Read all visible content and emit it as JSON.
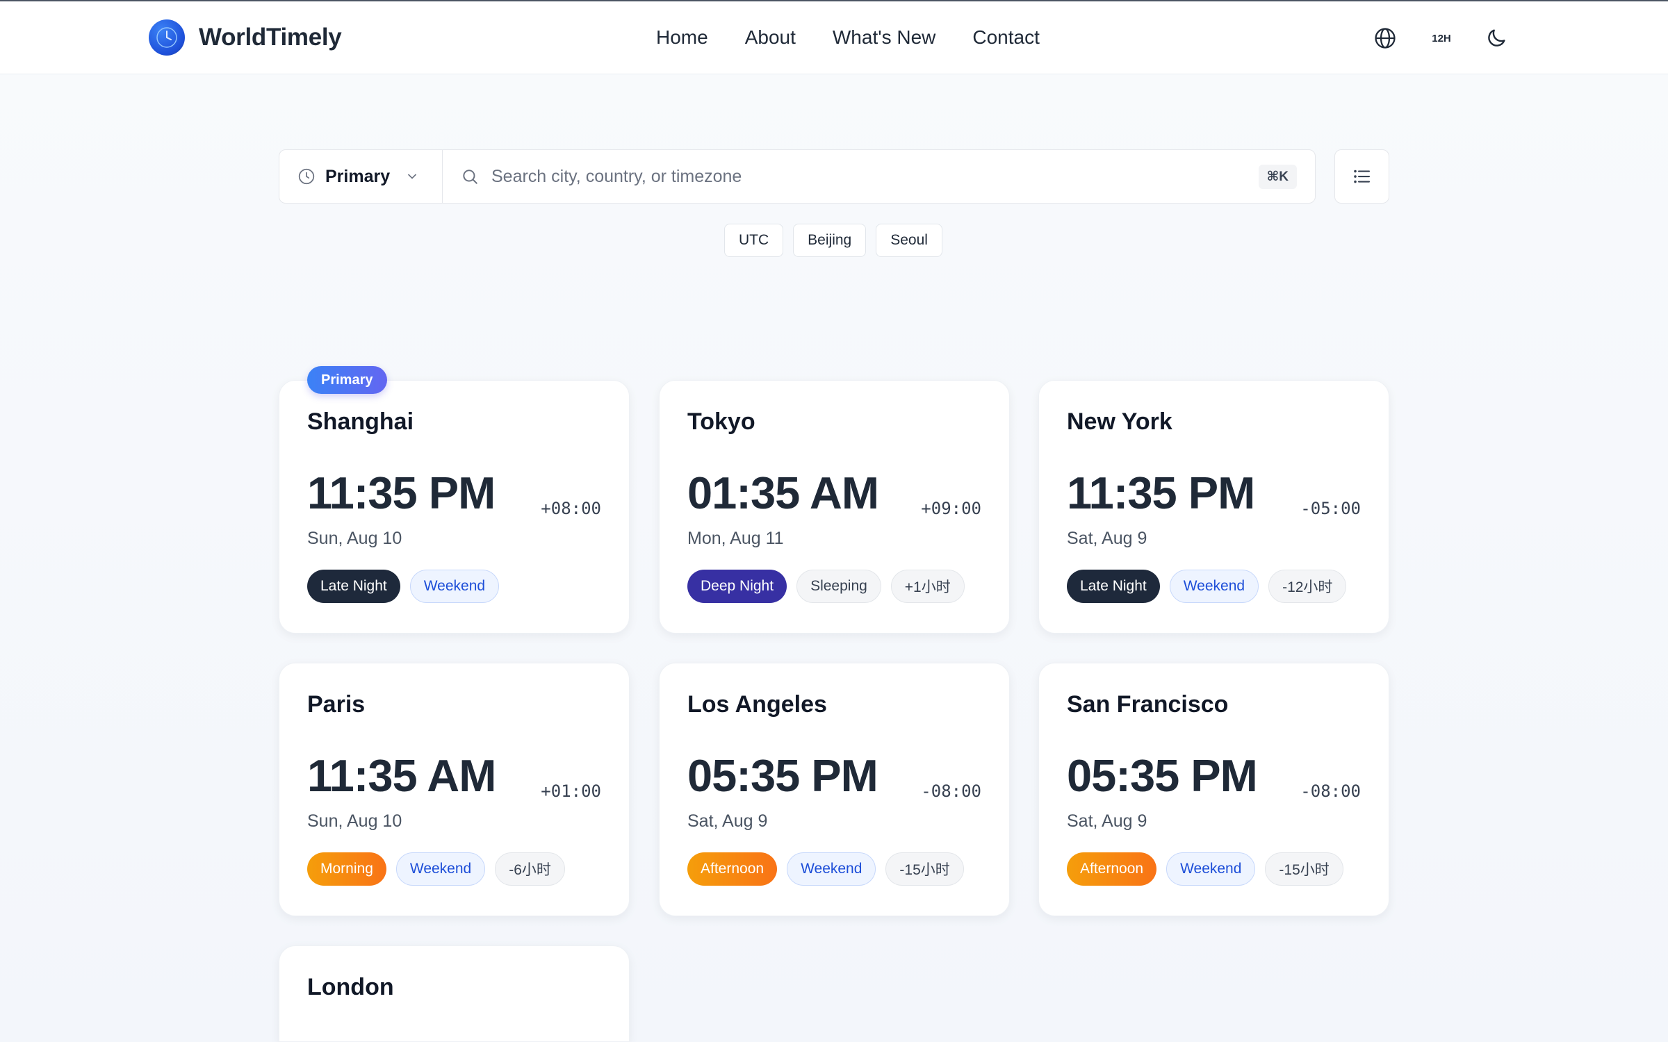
{
  "app": {
    "name": "WorldTimely"
  },
  "nav": {
    "items": [
      "Home",
      "About",
      "What's New",
      "Contact"
    ]
  },
  "header": {
    "time_format": "12H"
  },
  "search": {
    "mode": "Primary",
    "placeholder": "Search city, country, or timezone",
    "shortcut": "⌘K"
  },
  "quick_chips": [
    "UTC",
    "Beijing",
    "Seoul"
  ],
  "primary_badge": "Primary",
  "cards": [
    {
      "city": "Shanghai",
      "time": "11:35 PM",
      "offset": "+08:00",
      "date": "Sun, Aug 10",
      "tags": [
        {
          "label": "Late Night",
          "style": "dark"
        },
        {
          "label": "Weekend",
          "style": "blue"
        }
      ]
    },
    {
      "city": "Tokyo",
      "time": "01:35 AM",
      "offset": "+09:00",
      "date": "Mon, Aug 11",
      "tags": [
        {
          "label": "Deep Night",
          "style": "indigo"
        },
        {
          "label": "Sleeping",
          "style": "grey"
        },
        {
          "label": "+1小时",
          "style": "grey"
        }
      ]
    },
    {
      "city": "New York",
      "time": "11:35 PM",
      "offset": "-05:00",
      "date": "Sat, Aug 9",
      "tags": [
        {
          "label": "Late Night",
          "style": "dark"
        },
        {
          "label": "Weekend",
          "style": "blue"
        },
        {
          "label": "-12小时",
          "style": "grey"
        }
      ]
    },
    {
      "city": "Paris",
      "time": "11:35 AM",
      "offset": "+01:00",
      "date": "Sun, Aug 10",
      "tags": [
        {
          "label": "Morning",
          "style": "orange"
        },
        {
          "label": "Weekend",
          "style": "blue"
        },
        {
          "label": "-6小时",
          "style": "grey"
        }
      ]
    },
    {
      "city": "Los Angeles",
      "time": "05:35 PM",
      "offset": "-08:00",
      "date": "Sat, Aug 9",
      "tags": [
        {
          "label": "Afternoon",
          "style": "orange"
        },
        {
          "label": "Weekend",
          "style": "blue"
        },
        {
          "label": "-15小时",
          "style": "grey"
        }
      ]
    },
    {
      "city": "San Francisco",
      "time": "05:35 PM",
      "offset": "-08:00",
      "date": "Sat, Aug 9",
      "tags": [
        {
          "label": "Afternoon",
          "style": "orange"
        },
        {
          "label": "Weekend",
          "style": "blue"
        },
        {
          "label": "-15小时",
          "style": "grey"
        }
      ]
    },
    {
      "city": "London",
      "time": "",
      "offset": "",
      "date": "",
      "tags": []
    }
  ],
  "colors": {
    "brand": "#1d4ed8",
    "primary_badge": "#4f6ef7",
    "tag_dark": "#1e293b",
    "tag_indigo": "#3730a3",
    "tag_blue_text": "#1d4ed8",
    "tag_orange": "#f59e0b"
  }
}
